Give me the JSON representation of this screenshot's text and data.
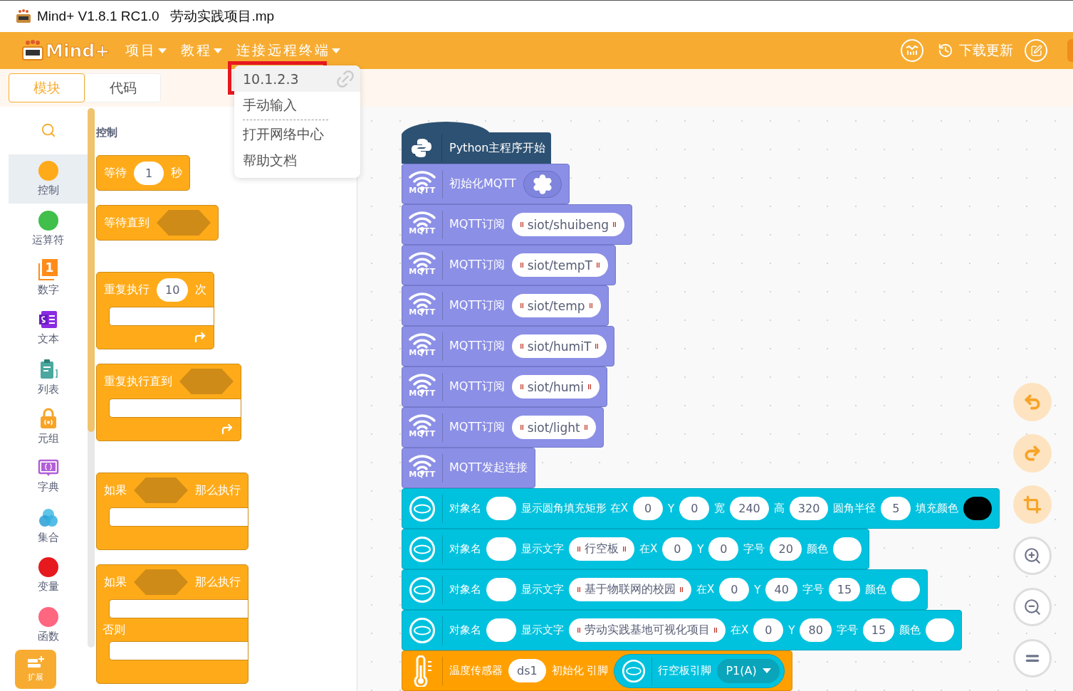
{
  "window": {
    "title": "Mind+ V1.8.1 RC1.0   劳动实践项目.mp"
  },
  "menubar": {
    "logo": "Mind+",
    "menus": [
      {
        "label": "项目"
      },
      {
        "label": "教程"
      },
      {
        "label": "连接远程终端"
      }
    ],
    "update": "下载更新"
  },
  "mode_tabs": [
    {
      "label": "模块",
      "selected": true
    },
    {
      "label": "代码",
      "selected": false
    }
  ],
  "dropdown": {
    "items": [
      {
        "label": "10.1.2.3",
        "selected": true,
        "divider_after": false
      },
      {
        "label": "手动输入",
        "selected": false,
        "divider_after": true
      },
      {
        "label": "打开网络中心",
        "selected": false,
        "divider_after": false
      },
      {
        "label": "帮助文档",
        "selected": false,
        "divider_after": false
      }
    ]
  },
  "categories": [
    {
      "label": "控制",
      "kind": "dot",
      "color": "#ffab19",
      "selected": true
    },
    {
      "label": "运算符",
      "kind": "dot",
      "color": "#40bf4a",
      "selected": false
    },
    {
      "label": "数字",
      "kind": "number",
      "badge": "1",
      "selected": false
    },
    {
      "label": "文本",
      "kind": "text",
      "selected": false
    },
    {
      "label": "列表",
      "kind": "list",
      "selected": false
    },
    {
      "label": "元组",
      "kind": "tuple",
      "selected": false
    },
    {
      "label": "字典",
      "kind": "dict",
      "selected": false
    },
    {
      "label": "集合",
      "kind": "set",
      "selected": false
    },
    {
      "label": "变量",
      "kind": "dot",
      "color": "#e6191e",
      "selected": false
    },
    {
      "label": "函数",
      "kind": "dot",
      "color": "#ff6680",
      "selected": false
    }
  ],
  "extension": {
    "label": "扩展"
  },
  "palette": {
    "title": "控制",
    "blocks": [
      {
        "kind": "stack",
        "parts": [
          {
            "kind": "label",
            "text": "等待"
          },
          {
            "kind": "number",
            "text": "1"
          },
          {
            "kind": "label",
            "text": "秒"
          }
        ]
      },
      {
        "kind": "stack",
        "parts": [
          {
            "kind": "label",
            "text": "等待直到"
          },
          {
            "kind": "boolean"
          }
        ]
      },
      {
        "kind": "loop",
        "parts": [
          {
            "kind": "label",
            "text": "重复执行"
          },
          {
            "kind": "number",
            "text": "10"
          },
          {
            "kind": "label",
            "text": "次"
          }
        ]
      },
      {
        "kind": "loop",
        "parts": [
          {
            "kind": "label",
            "text": "重复执行直到"
          },
          {
            "kind": "boolean"
          }
        ]
      },
      {
        "kind": "if",
        "parts": [
          {
            "kind": "label",
            "text": "如果"
          },
          {
            "kind": "boolean"
          },
          {
            "kind": "label",
            "text": "那么执行"
          }
        ]
      },
      {
        "kind": "if-else",
        "else_label": "否则",
        "parts": [
          {
            "kind": "label",
            "text": "如果"
          },
          {
            "kind": "boolean"
          },
          {
            "kind": "label",
            "text": "那么执行"
          }
        ]
      }
    ]
  },
  "script": {
    "hat": "Python主程序开始",
    "blocks": [
      {
        "kind": "mqtt",
        "badge": "MQTT",
        "parts": [
          {
            "kind": "label",
            "text": "初始化MQTT"
          },
          {
            "kind": "gear"
          }
        ]
      },
      {
        "kind": "mqtt",
        "badge": "MQTT",
        "parts": [
          {
            "kind": "label",
            "text": "MQTT订阅"
          },
          {
            "kind": "string",
            "text": "siot/shuibeng"
          }
        ]
      },
      {
        "kind": "mqtt",
        "badge": "MQTT",
        "parts": [
          {
            "kind": "label",
            "text": "MQTT订阅"
          },
          {
            "kind": "string",
            "text": "siot/tempT"
          }
        ]
      },
      {
        "kind": "mqtt",
        "badge": "MQTT",
        "parts": [
          {
            "kind": "label",
            "text": "MQTT订阅"
          },
          {
            "kind": "string",
            "text": "siot/temp"
          }
        ]
      },
      {
        "kind": "mqtt",
        "badge": "MQTT",
        "parts": [
          {
            "kind": "label",
            "text": "MQTT订阅"
          },
          {
            "kind": "string",
            "text": "siot/humiT"
          }
        ]
      },
      {
        "kind": "mqtt",
        "badge": "MQTT",
        "parts": [
          {
            "kind": "label",
            "text": "MQTT订阅"
          },
          {
            "kind": "string",
            "text": "siot/humi"
          }
        ]
      },
      {
        "kind": "mqtt",
        "badge": "MQTT",
        "parts": [
          {
            "kind": "label",
            "text": "MQTT订阅"
          },
          {
            "kind": "string",
            "text": "siot/light"
          }
        ]
      },
      {
        "kind": "mqtt",
        "badge": "MQTT",
        "parts": [
          {
            "kind": "label",
            "text": "MQTT发起连接"
          }
        ]
      },
      {
        "kind": "display",
        "parts": [
          {
            "kind": "label",
            "text": "对象名"
          },
          {
            "kind": "empty"
          },
          {
            "kind": "label",
            "text": "显示圆角填充矩形 在X"
          },
          {
            "kind": "number",
            "text": "0"
          },
          {
            "kind": "label",
            "text": "Y"
          },
          {
            "kind": "number",
            "text": "0"
          },
          {
            "kind": "label",
            "text": "宽"
          },
          {
            "kind": "number",
            "text": "240"
          },
          {
            "kind": "label",
            "text": "高"
          },
          {
            "kind": "number",
            "text": "320"
          },
          {
            "kind": "label",
            "text": "圆角半径"
          },
          {
            "kind": "number",
            "text": "5"
          },
          {
            "kind": "label",
            "text": "填充颜色"
          },
          {
            "kind": "color",
            "color": "#000000"
          }
        ]
      },
      {
        "kind": "display",
        "parts": [
          {
            "kind": "label",
            "text": "对象名"
          },
          {
            "kind": "empty"
          },
          {
            "kind": "label",
            "text": "显示文字"
          },
          {
            "kind": "string",
            "text": "行空板"
          },
          {
            "kind": "label",
            "text": "在X"
          },
          {
            "kind": "number",
            "text": "0"
          },
          {
            "kind": "label",
            "text": "Y"
          },
          {
            "kind": "number",
            "text": "0"
          },
          {
            "kind": "label",
            "text": "字号"
          },
          {
            "kind": "number",
            "text": "20"
          },
          {
            "kind": "label",
            "text": "颜色"
          },
          {
            "kind": "color",
            "color": "#ffffff"
          }
        ]
      },
      {
        "kind": "display",
        "parts": [
          {
            "kind": "label",
            "text": "对象名"
          },
          {
            "kind": "empty"
          },
          {
            "kind": "label",
            "text": "显示文字"
          },
          {
            "kind": "string",
            "text": "基于物联网的校园"
          },
          {
            "kind": "label",
            "text": "在X"
          },
          {
            "kind": "number",
            "text": "0"
          },
          {
            "kind": "label",
            "text": "Y"
          },
          {
            "kind": "number",
            "text": "40"
          },
          {
            "kind": "label",
            "text": "字号"
          },
          {
            "kind": "number",
            "text": "15"
          },
          {
            "kind": "label",
            "text": "颜色"
          },
          {
            "kind": "color",
            "color": "#ffffff"
          }
        ]
      },
      {
        "kind": "display",
        "parts": [
          {
            "kind": "label",
            "text": "对象名"
          },
          {
            "kind": "empty"
          },
          {
            "kind": "label",
            "text": "显示文字"
          },
          {
            "kind": "string",
            "text": "劳动实践基地可视化项目"
          },
          {
            "kind": "label",
            "text": "在X"
          },
          {
            "kind": "number",
            "text": "0"
          },
          {
            "kind": "label",
            "text": "Y"
          },
          {
            "kind": "number",
            "text": "80"
          },
          {
            "kind": "label",
            "text": "字号"
          },
          {
            "kind": "number",
            "text": "15"
          },
          {
            "kind": "label",
            "text": "颜色"
          },
          {
            "kind": "color",
            "color": "#ffffff"
          }
        ]
      },
      {
        "kind": "sensor",
        "parts": [
          {
            "kind": "label",
            "text": "温度传感器"
          },
          {
            "kind": "number",
            "text": "ds1"
          },
          {
            "kind": "label",
            "text": "初始化 引脚"
          },
          {
            "kind": "pin",
            "label": "行空板引脚",
            "value": "P1(A)"
          }
        ]
      }
    ]
  }
}
